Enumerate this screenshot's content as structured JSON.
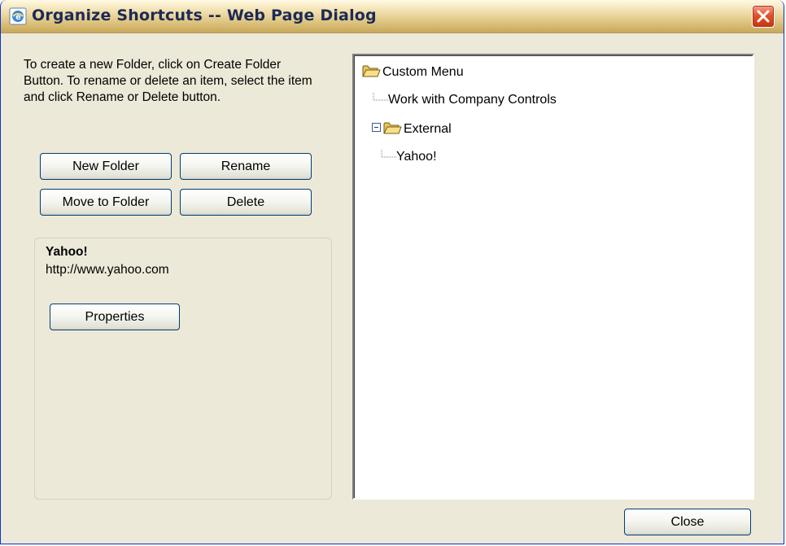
{
  "window": {
    "title": "Organize Shortcuts -- Web Page Dialog",
    "title_icon": "ie-page-icon",
    "close_icon": "close-x-icon"
  },
  "instructions": "To create a new Folder, click on Create Folder Button. To rename or delete an item, select the item and click Rename or Delete button.",
  "buttons": {
    "new_folder": "New Folder",
    "rename": "Rename",
    "move_to_folder": "Move to Folder",
    "delete": "Delete",
    "properties": "Properties",
    "close": "Close"
  },
  "selected_item": {
    "name": "Yahoo!",
    "url": "http://www.yahoo.com"
  },
  "tree": {
    "root": "Custom Menu",
    "items": [
      {
        "label": "Work with Company Controls"
      },
      {
        "label": "External"
      },
      {
        "label": "Yahoo!"
      }
    ]
  }
}
